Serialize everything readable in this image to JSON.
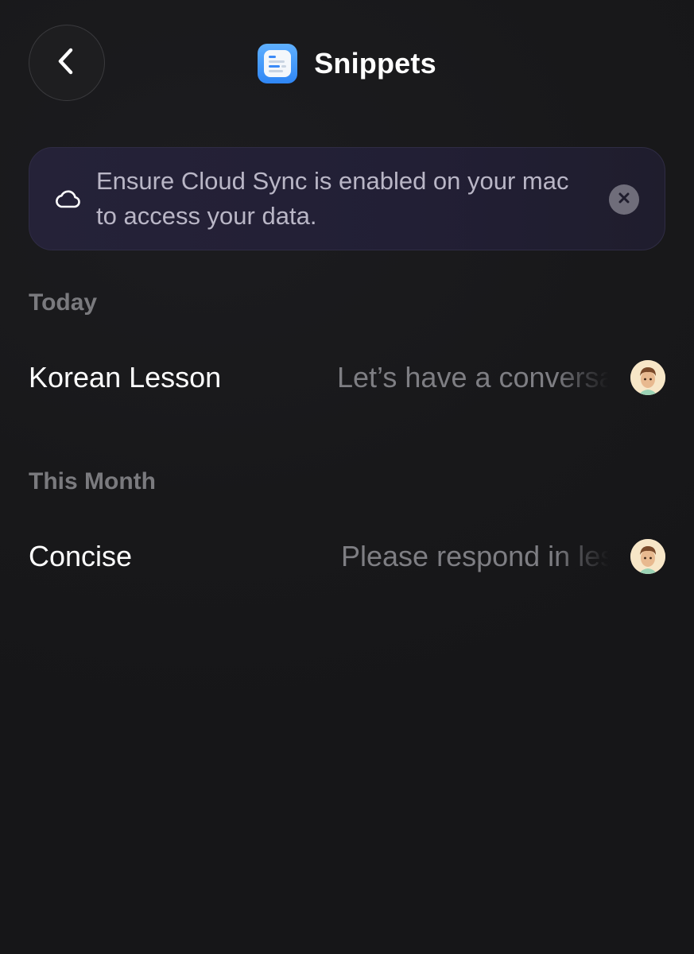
{
  "header": {
    "title": "Snippets",
    "back_icon": "chevron-left-icon",
    "app_icon": "snippets-app-icon"
  },
  "banner": {
    "icon": "cloud-icon",
    "text": "Ensure Cloud Sync is enabled on your mac to access your data.",
    "close_icon": "close-icon"
  },
  "sections": [
    {
      "label": "Today",
      "items": [
        {
          "title": "Korean Lesson",
          "preview": "Let’s have a conversation"
        }
      ]
    },
    {
      "label": "This Month",
      "items": [
        {
          "title": "Concise",
          "preview": "Please respond in less words"
        }
      ]
    }
  ],
  "colors": {
    "background": "#19191b",
    "banner": "#252238",
    "section_label": "#7a7a7e",
    "preview_text": "#7e7e83",
    "accent": "#2f86f5"
  }
}
